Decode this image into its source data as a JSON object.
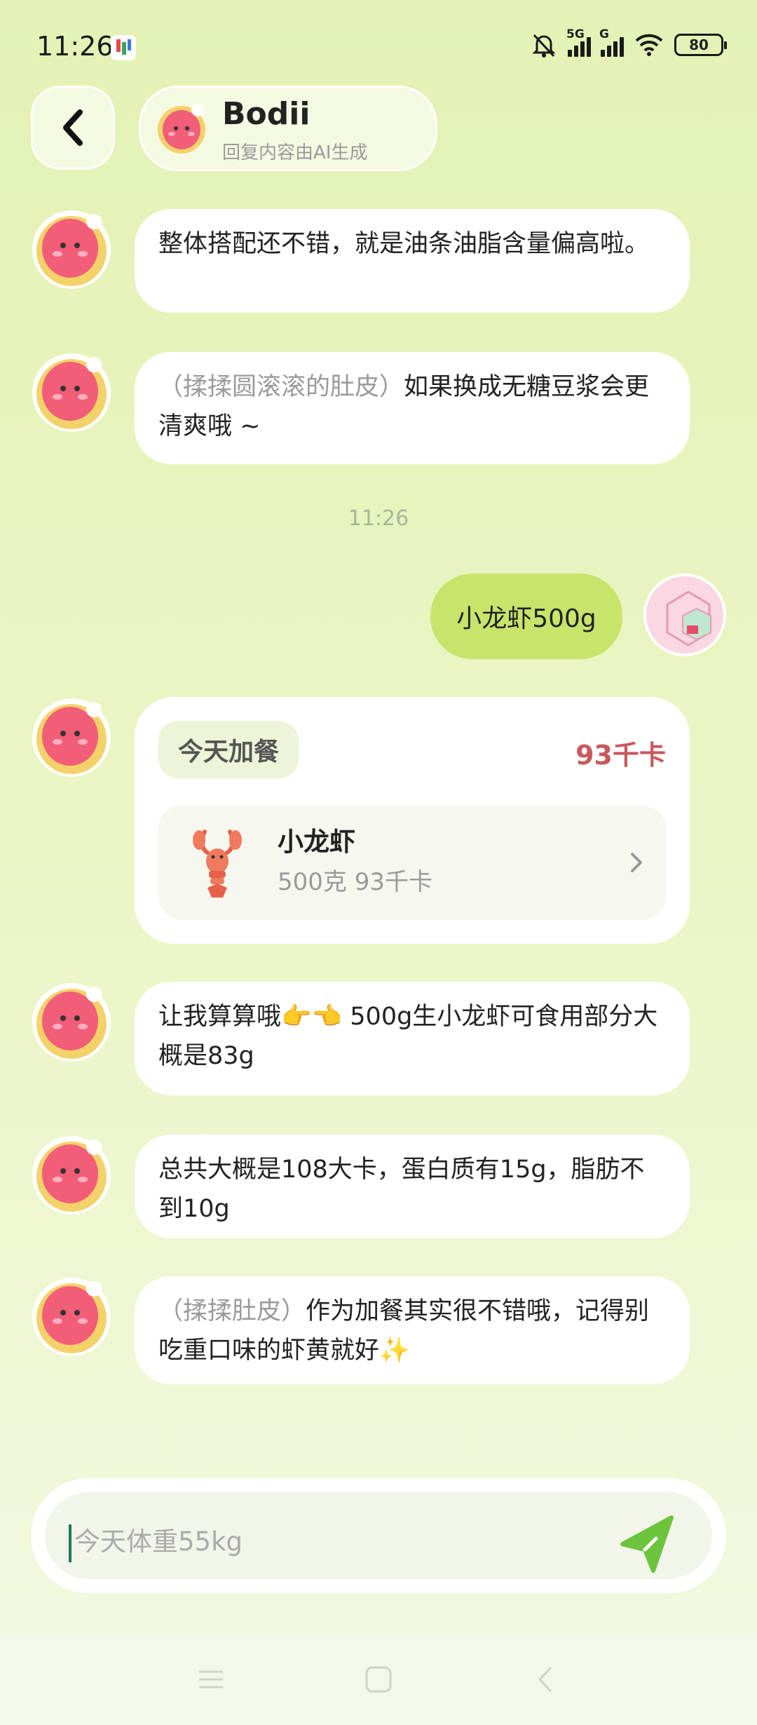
{
  "status_bar": {
    "time": "11:26",
    "network_1": "5G",
    "network_2": "G",
    "battery": "80"
  },
  "header": {
    "name": "Bodii",
    "subtitle": "回复内容由AI生成"
  },
  "messages": {
    "m1": "整体搭配还不错，就是油条油脂含量偏高啦。",
    "m2_action": "（揉揉圆滚滚的肚皮）",
    "m2_text": "如果换成无糖豆浆会更清爽哦 ~",
    "timestamp": "11:26",
    "user_msg": "小龙虾500g",
    "m4": "让我算算哦👉👈 500g生小龙虾可食用部分大概是83g",
    "m5": "总共大概是108大卡，蛋白质有15g，脂肪不到10g",
    "m6_action": "（揉揉肚皮）",
    "m6_text": "作为加餐其实很不错哦，记得别吃重口味的虾黄就好✨"
  },
  "food_card": {
    "meal": "今天加餐",
    "total": "93千卡",
    "item_name": "小龙虾",
    "item_detail": "500克 93千卡"
  },
  "input": {
    "placeholder": "今天体重55kg"
  },
  "colors": {
    "accent": "#c9e46a",
    "kcal_red": "#c9585e",
    "send_green": "#6cc43c"
  },
  "icons": [
    "back-icon",
    "send-icon",
    "crayfish-icon",
    "chevron-right-icon",
    "mute-icon",
    "wifi-icon"
  ]
}
